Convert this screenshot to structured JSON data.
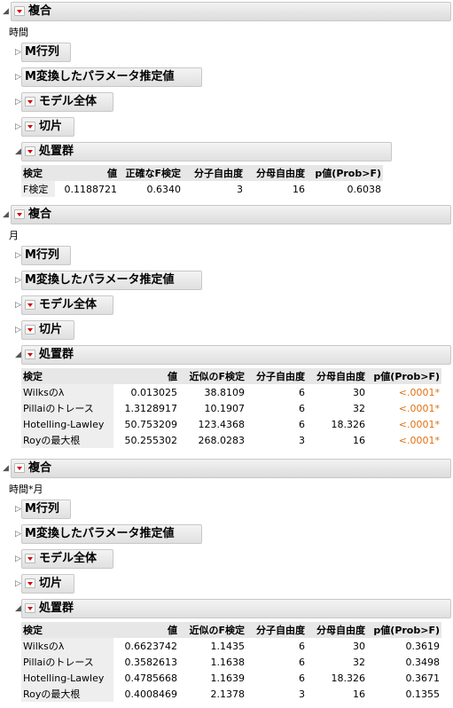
{
  "sections": [
    {
      "title": "複合",
      "sublabel": "時間",
      "rows": [
        "M行列",
        "M変換したパラメータ推定値",
        "モデル全体",
        "切片",
        "処置群"
      ],
      "table": {
        "headers": [
          "検定",
          "値",
          "正確なF検定",
          "分子自由度",
          "分母自由度",
          "p値(Prob>F)"
        ],
        "rows": [
          [
            "F検定",
            "0.1188721",
            "0.6340",
            "3",
            "16",
            "0.6038"
          ]
        ]
      }
    },
    {
      "title": "複合",
      "sublabel": "月",
      "rows": [
        "M行列",
        "M変換したパラメータ推定値",
        "モデル全体",
        "切片",
        "処置群"
      ],
      "table": {
        "headers": [
          "検定",
          "値",
          "近似のF検定",
          "分子自由度",
          "分母自由度",
          "p値(Prob>F)"
        ],
        "rows": [
          [
            "Wilksのλ",
            "0.013025",
            "38.8109",
            "6",
            "30",
            "<.0001*"
          ],
          [
            "Pillaiのトレース",
            "1.3128917",
            "10.1907",
            "6",
            "32",
            "<.0001*"
          ],
          [
            "Hotelling-Lawley",
            "50.753209",
            "123.4368",
            "6",
            "18.326",
            "<.0001*"
          ],
          [
            "Royの最大根",
            "50.255302",
            "268.0283",
            "3",
            "16",
            "<.0001*"
          ]
        ]
      }
    },
    {
      "title": "複合",
      "sublabel": "時間*月",
      "rows": [
        "M行列",
        "M変換したパラメータ推定値",
        "モデル全体",
        "切片",
        "処置群"
      ],
      "table": {
        "headers": [
          "検定",
          "値",
          "近似のF検定",
          "分子自由度",
          "分母自由度",
          "p値(Prob>F)"
        ],
        "rows": [
          [
            "Wilksのλ",
            "0.6623742",
            "1.1435",
            "6",
            "30",
            "0.3619"
          ],
          [
            "Pillaiのトレース",
            "0.3582613",
            "1.1638",
            "6",
            "32",
            "0.3498"
          ],
          [
            "Hotelling-Lawley",
            "0.4785668",
            "1.1639",
            "6",
            "18.326",
            "0.3671"
          ],
          [
            "Royの最大根",
            "0.4008469",
            "2.1378",
            "3",
            "16",
            "0.1355"
          ]
        ]
      }
    }
  ],
  "colors": {
    "red_triangle": "#d40000",
    "significant_p": "#e07010"
  }
}
